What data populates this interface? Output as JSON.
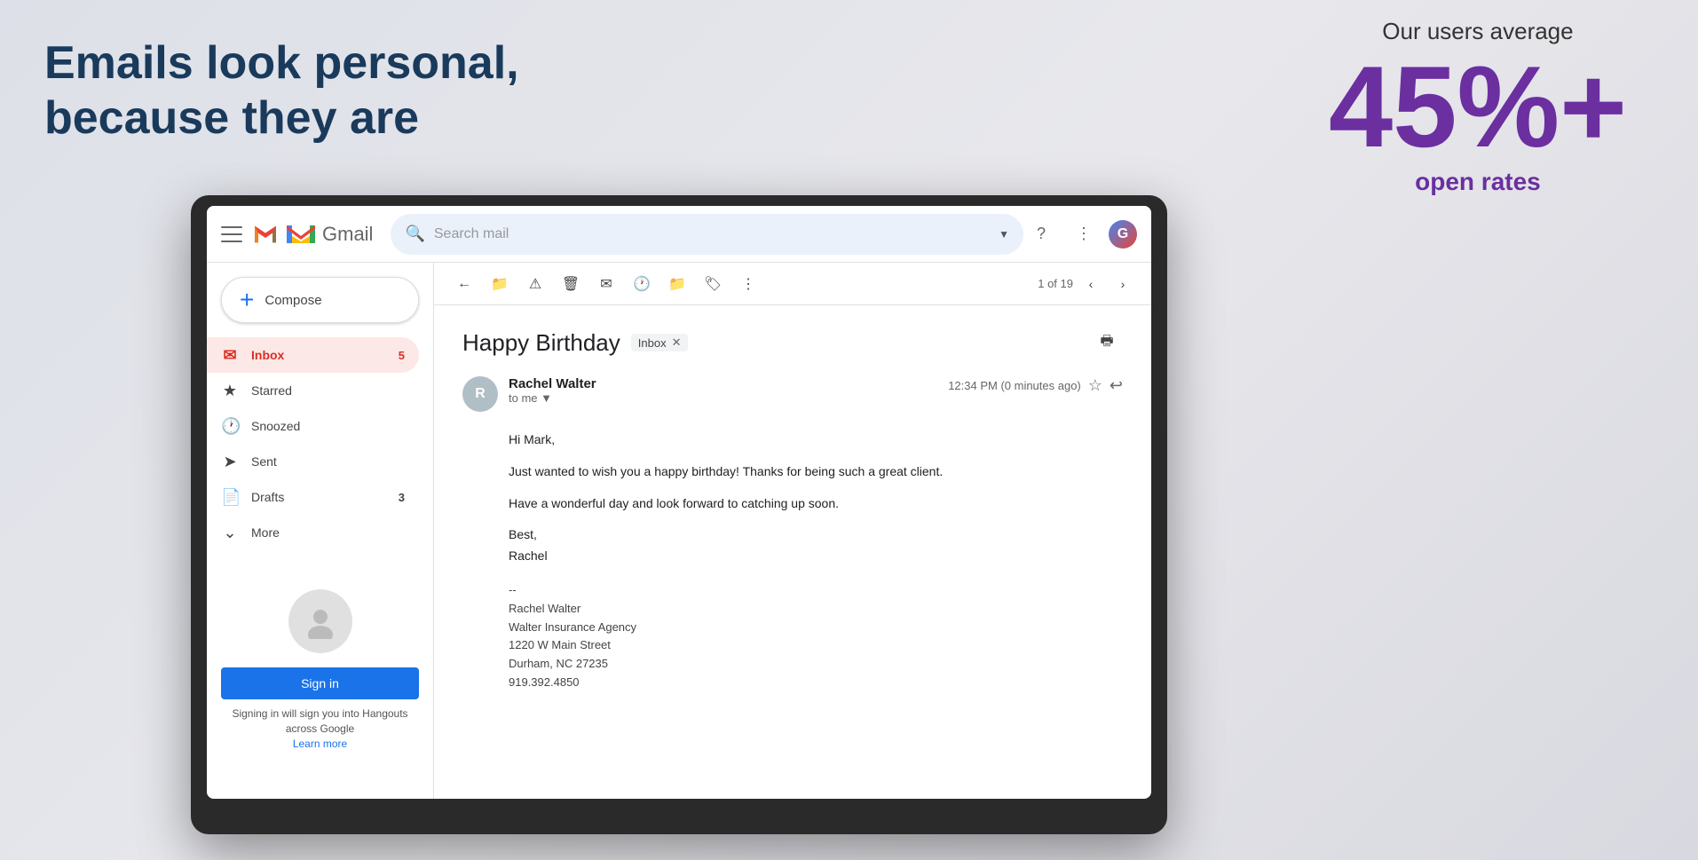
{
  "page": {
    "background_color": "#e8e8ec"
  },
  "headline": {
    "line1": "Emails look personal,",
    "line2": "because they are"
  },
  "stats": {
    "label_top": "Our users average",
    "number": "45%+",
    "label_bottom": "open rates"
  },
  "gmail": {
    "app_name": "Gmail",
    "header": {
      "search_placeholder": "Search mail",
      "hamburger_label": "Menu"
    },
    "sidebar": {
      "compose_label": "Compose",
      "nav_items": [
        {
          "id": "inbox",
          "label": "Inbox",
          "badge": "5",
          "active": true,
          "icon": "inbox"
        },
        {
          "id": "starred",
          "label": "Starred",
          "badge": "",
          "active": false,
          "icon": "star"
        },
        {
          "id": "snoozed",
          "label": "Snoozed",
          "badge": "",
          "active": false,
          "icon": "clock"
        },
        {
          "id": "sent",
          "label": "Sent",
          "badge": "",
          "active": false,
          "icon": "sent"
        },
        {
          "id": "drafts",
          "label": "Drafts",
          "badge": "3",
          "active": false,
          "icon": "draft"
        },
        {
          "id": "more",
          "label": "More",
          "badge": "",
          "active": false,
          "icon": "chevron"
        }
      ],
      "sign_in_label": "Sign in",
      "hangouts_text": "Signing in will sign you into Hangouts across Google",
      "hangouts_link": "Learn more"
    },
    "email": {
      "subject": "Happy Birthday",
      "tag": "Inbox",
      "sender_name": "Rachel Walter",
      "sender_to": "to me",
      "timestamp": "12:34 PM (0 minutes ago)",
      "pagination": "1 of 19",
      "body_greeting": "Hi Mark,",
      "body_line1": "Just wanted to wish you a happy birthday!  Thanks for being such a great client.",
      "body_line2": "Have a wonderful day and look forward to catching up soon.",
      "body_closing": "Best,",
      "body_closing2": "Rachel",
      "signature_separator": "--",
      "sig_name": "Rachel Walter",
      "sig_company": "Walter Insurance Agency",
      "sig_address": "1220 W Main Street",
      "sig_city": "Durham, NC 27235",
      "sig_phone": "919.392.4850"
    },
    "toolbar": {
      "back_label": "Back",
      "archive_label": "Archive",
      "spam_label": "Report spam",
      "delete_label": "Delete",
      "email_label": "Mark as read",
      "snooze_label": "Snooze",
      "move_label": "Move to",
      "labels_label": "Labels",
      "more_label": "More"
    }
  }
}
